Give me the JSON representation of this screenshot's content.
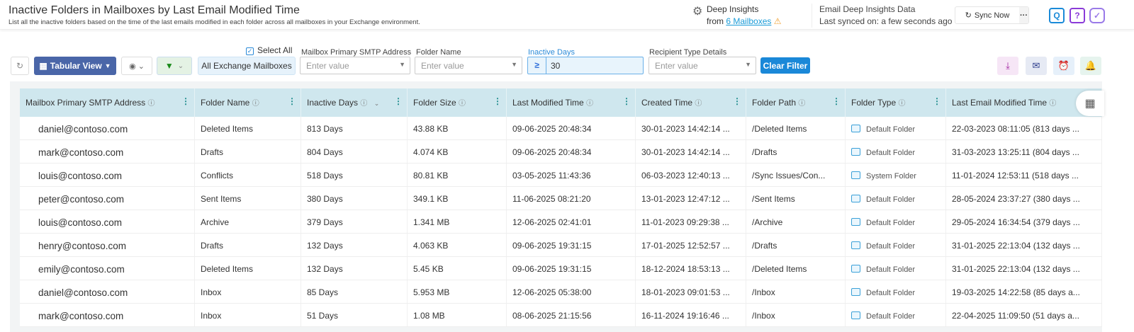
{
  "header": {
    "title": "Inactive Folders in Mailboxes by Last Email Modified Time",
    "subtitle": "List all the inactive folders based on the time of the last emails modified in each folder across all mailboxes in your Exchange environment.",
    "deep_insights": "Deep Insights",
    "from": "from",
    "mailboxes_link": "6 Mailboxes",
    "data_title": "Email Deep Insights Data",
    "last_synced": "Last synced on: a few seconds ago",
    "sync_label": "Sync Now",
    "more": "···",
    "search": "Q",
    "help": "?",
    "check": "✓"
  },
  "toolbar": {
    "view_label": "Tabular View",
    "select_all": "Select All",
    "scope": "All Exchange Mailboxes",
    "clear_filter": "Clear Filter"
  },
  "filters": [
    {
      "label": "Mailbox Primary SMTP Address",
      "placeholder": "Enter value"
    },
    {
      "label": "Folder Name",
      "placeholder": "Enter value"
    },
    {
      "label": "Inactive Days",
      "operator": "≥",
      "value": "30"
    },
    {
      "label": "Recipient Type Details",
      "placeholder": "Enter value"
    }
  ],
  "columns": [
    "Mailbox Primary SMTP Address",
    "Folder Name",
    "Inactive Days",
    "Folder Size",
    "Last Modified Time",
    "Created Time",
    "Folder Path",
    "Folder Type",
    "Last Email Modified Time"
  ],
  "rows": [
    [
      "daniel@contoso.com",
      "Deleted Items",
      "813 Days",
      "43.88 KB",
      "09-06-2025 20:48:34",
      "30-01-2023 14:42:14 ...",
      "/Deleted Items",
      "Default Folder",
      "22-03-2023 08:11:05 (813 days ..."
    ],
    [
      "mark@contoso.com",
      "Drafts",
      "804 Days",
      "4.074 KB",
      "09-06-2025 20:48:34",
      "30-01-2023 14:42:14 ...",
      "/Drafts",
      "Default Folder",
      "31-03-2023 13:25:11 (804 days ..."
    ],
    [
      "louis@contoso.com",
      "Conflicts",
      "518 Days",
      "80.81 KB",
      "03-05-2025 11:43:36",
      "06-03-2023 12:40:13 ...",
      "/Sync Issues/Con...",
      "System Folder",
      "11-01-2024 12:53:11 (518 days ..."
    ],
    [
      "peter@contoso.com",
      "Sent Items",
      "380 Days",
      "349.1 KB",
      "11-06-2025 08:21:20",
      "13-01-2023 12:47:12 ...",
      "/Sent Items",
      "Default Folder",
      "28-05-2024 23:37:27 (380 days ..."
    ],
    [
      "louis@contoso.com",
      "Archive",
      "379 Days",
      "1.341 MB",
      "12-06-2025 02:41:01",
      "11-01-2023 09:29:38 ...",
      "/Archive",
      "Default Folder",
      "29-05-2024 16:34:54 (379 days ..."
    ],
    [
      "henry@contoso.com",
      "Drafts",
      "132 Days",
      "4.063 KB",
      "09-06-2025 19:31:15",
      "17-01-2025 12:52:57 ...",
      "/Drafts",
      "Default Folder",
      "31-01-2025 22:13:04 (132 days ..."
    ],
    [
      "emily@contoso.com",
      "Deleted Items",
      "132 Days",
      "5.45 KB",
      "09-06-2025 19:31:15",
      "18-12-2024 18:53:13 ...",
      "/Deleted Items",
      "Default Folder",
      "31-01-2025 22:13:04 (132 days ..."
    ],
    [
      "daniel@contoso.com",
      "Inbox",
      "85 Days",
      "5.953 MB",
      "12-06-2025 05:38:00",
      "18-01-2023 09:01:53 ...",
      "/Inbox",
      "Default Folder",
      "19-03-2025 14:22:58 (85 days a..."
    ],
    [
      "mark@contoso.com",
      "Inbox",
      "51 Days",
      "1.08 MB",
      "08-06-2025 21:15:56",
      "16-11-2024 19:16:46 ...",
      "/Inbox",
      "Default Folder",
      "22-04-2025 11:09:50 (51 days a..."
    ]
  ]
}
